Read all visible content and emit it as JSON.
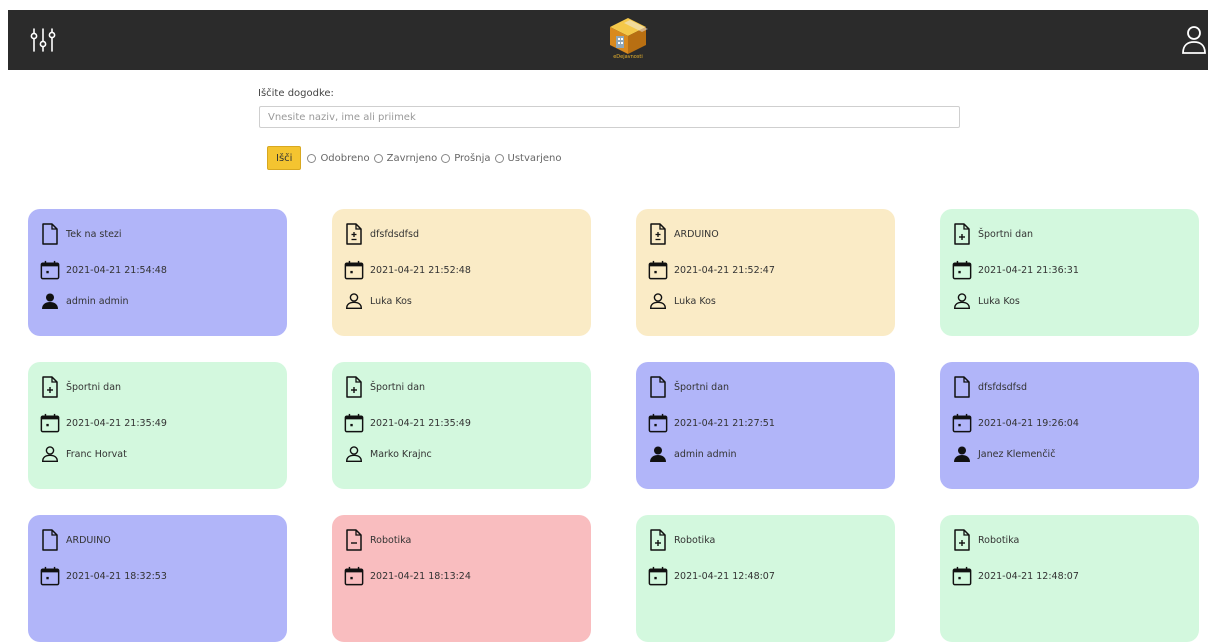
{
  "header": {
    "logo_text": "eDejavnosti",
    "icons": {
      "filters": "sliders-icon",
      "user": "user-icon",
      "logo": "cube-logo"
    }
  },
  "search": {
    "label": "Iščite dogodke:",
    "placeholder": "Vnesite naziv, ime ali priimek",
    "value": "",
    "button_label": "Išči",
    "filters": [
      "Odobreno",
      "Zavrnjeno",
      "Prošnja",
      "Ustvarjeno"
    ]
  },
  "colors": {
    "created": "#b1b5f9",
    "pending": "#faebc6",
    "approved": "#d3f8de",
    "rejected": "#f9bdbf",
    "search_button": "#f4c430",
    "header_bg": "#2b2b2b"
  },
  "events": [
    {
      "title": "Tek na stezi",
      "datetime": "2021-04-21 21:54:48",
      "user": "admin admin",
      "status": "created"
    },
    {
      "title": "dfsfdsdfsd",
      "datetime": "2021-04-21 21:52:48",
      "user": "Luka Kos",
      "status": "pending"
    },
    {
      "title": "ARDUINO",
      "datetime": "2021-04-21 21:52:47",
      "user": "Luka Kos",
      "status": "pending"
    },
    {
      "title": "Športni dan",
      "datetime": "2021-04-21 21:36:31",
      "user": "Luka Kos",
      "status": "approved"
    },
    {
      "title": "Športni dan",
      "datetime": "2021-04-21 21:35:49",
      "user": "Franc Horvat",
      "status": "approved"
    },
    {
      "title": "Športni dan",
      "datetime": "2021-04-21 21:35:49",
      "user": "Marko Krajnc",
      "status": "approved"
    },
    {
      "title": "Športni dan",
      "datetime": "2021-04-21 21:27:51",
      "user": "admin admin",
      "status": "created"
    },
    {
      "title": "dfsfdsdfsd",
      "datetime": "2021-04-21 19:26:04",
      "user": "Janez Klemenčič",
      "status": "created"
    },
    {
      "title": "ARDUINO",
      "datetime": "2021-04-21 18:32:53",
      "user": "",
      "status": "created"
    },
    {
      "title": "Robotika",
      "datetime": "2021-04-21 18:13:24",
      "user": "",
      "status": "rejected"
    },
    {
      "title": "Robotika",
      "datetime": "2021-04-21 12:48:07",
      "user": "",
      "status": "approved"
    },
    {
      "title": "Robotika",
      "datetime": "2021-04-21 12:48:07",
      "user": "",
      "status": "approved"
    }
  ]
}
